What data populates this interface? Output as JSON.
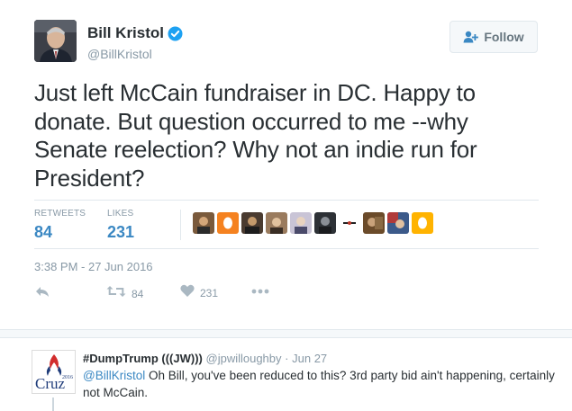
{
  "tweet": {
    "author_name": "Bill Kristol",
    "author_handle": "@BillKristol",
    "follow_label": "Follow",
    "text": "Just left McCain fundraiser in DC. Happy to donate. But question occurred to me --why Senate reelection? Why not an indie run for President?",
    "retweets_label": "RETWEETS",
    "retweets_count": "84",
    "likes_label": "LIKES",
    "likes_count": "231",
    "timestamp": "3:38 PM - 27 Jun 2016",
    "actions": {
      "retweet_count": "84",
      "like_count": "231"
    },
    "liker_avatars": [
      "#7a5a3c",
      "#f58220",
      "#4a3b30",
      "#9a7b5e",
      "#c9c4d6",
      "#2d3136",
      "#ffffff",
      "#6b4b2a",
      "#3c5a8a",
      "#ffb300"
    ]
  },
  "reply": {
    "author_name": "#DumpTrump (((JW)))",
    "author_handle": "@jpwilloughby",
    "separator": "·",
    "date": "Jun 27",
    "mention": "@BillKristol",
    "text": " Oh Bill, you've been reduced to this? 3rd party bid ain't happening, certainly not McCain.",
    "avatar_logo_text": "Cruz",
    "avatar_logo_year": "2016"
  },
  "colors": {
    "link": "#3b88c3",
    "muted": "#8899a6",
    "text": "#292f33",
    "verified": "#1da1f2"
  }
}
